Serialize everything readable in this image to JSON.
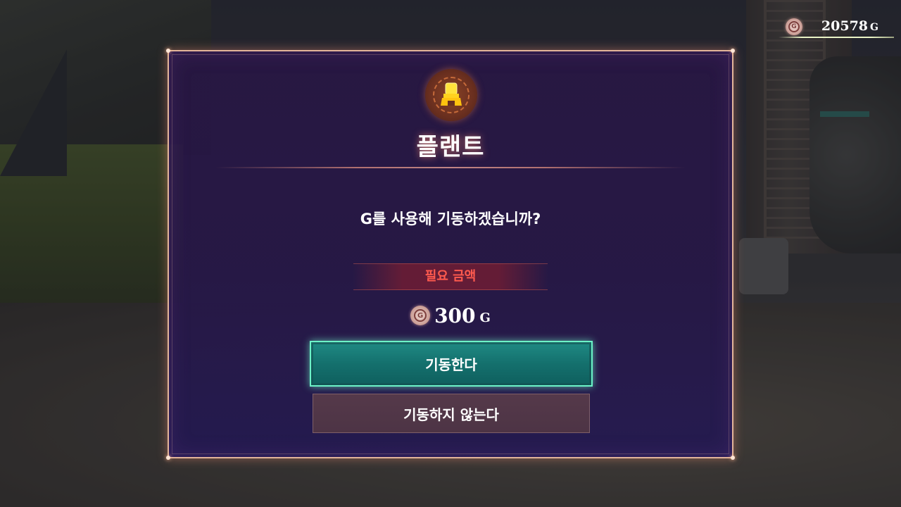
{
  "hud": {
    "gold_amount": "20578",
    "gold_unit": "G"
  },
  "dialog": {
    "icon": "plant-icon",
    "title": "플랜트",
    "question": "G를 사용해 기동하겠습니까?",
    "required_label": "필요 금액",
    "cost_amount": "300",
    "cost_unit": "G",
    "confirm_label": "기동한다",
    "cancel_label": "기동하지 않는다"
  },
  "colors": {
    "frame": "#e3b59a",
    "confirm_border": "#6cf3c8",
    "required_text": "#ff5a4e"
  }
}
